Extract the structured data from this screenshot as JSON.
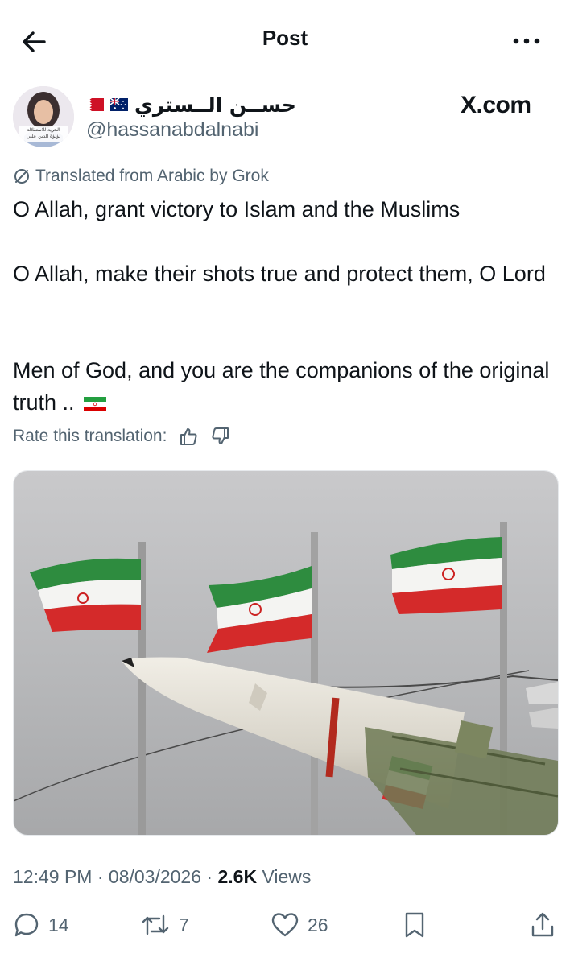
{
  "header": {
    "title": "Post"
  },
  "author": {
    "display_name": "حســن الــستري",
    "handle": "@hassanabdalnabi",
    "avatar_caption_line1": "الحرية للاستقلالة",
    "avatar_caption_line2": "لؤلؤة الدين عليي"
  },
  "brand_watermark": "X.com",
  "translation": {
    "label": "Translated from Arabic by Grok",
    "rate_label": "Rate this translation:"
  },
  "post": {
    "line1": "O Allah, grant victory to Islam and the Muslims",
    "line2": "O Allah, make their shots true and protect them, O Lord",
    "line3": "Men of God, and you are the companions of the original truth .."
  },
  "meta": {
    "time": "12:49 PM",
    "separator": "·",
    "date": "08/03/2026",
    "views_count": "2.6K",
    "views_label": "Views"
  },
  "actions": {
    "replies": "14",
    "reposts": "7",
    "likes": "26"
  },
  "colors": {
    "text": "#0f1419",
    "secondary": "#536471",
    "flag_green": "#239f40",
    "flag_red": "#da0000"
  }
}
